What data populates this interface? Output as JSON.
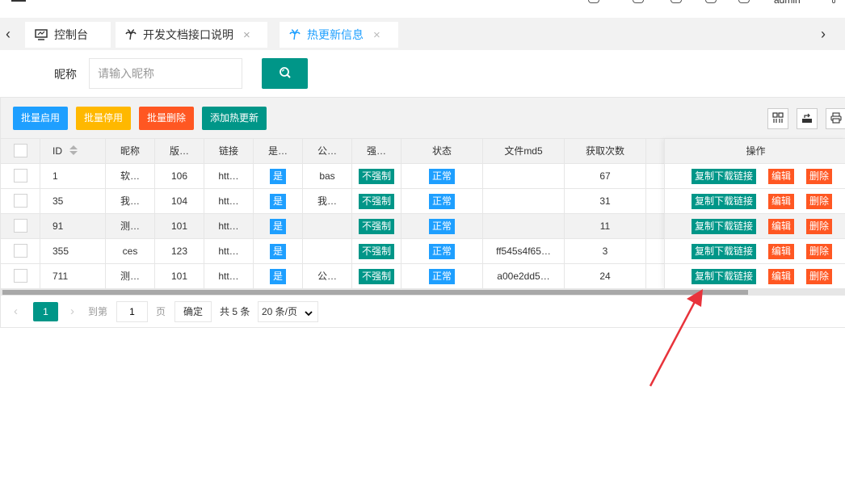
{
  "header": {
    "user_name": "admin"
  },
  "tabs": [
    {
      "label": "控制台",
      "icon": "monitor-icon",
      "closable": false,
      "active": false
    },
    {
      "label": "开发文档接口说明",
      "icon": "palm-icon",
      "closable": true,
      "active": false
    },
    {
      "label": "热更新信息",
      "icon": "palm-icon",
      "closable": true,
      "active": true
    }
  ],
  "search": {
    "label": "昵称",
    "placeholder": "请输入昵称",
    "button_icon": "search-icon"
  },
  "toolbar": {
    "batch_enable": "批量启用",
    "batch_disable": "批量停用",
    "batch_delete": "批量删除",
    "add_hot_update": "添加热更新",
    "colors": {
      "blue": "#1e9fff",
      "yellow": "#ffb800",
      "orange": "#ff5722",
      "green": "#009688"
    },
    "icons": [
      "columns-icon",
      "export-icon",
      "print-icon"
    ]
  },
  "table": {
    "headers": {
      "id": "ID",
      "nickname": "昵称",
      "version": "版…",
      "link": "链接",
      "is": "是…",
      "public": "公…",
      "force": "强…",
      "status": "状态",
      "md5": "文件md5",
      "fetch_count": "获取次数",
      "actions": "操作"
    },
    "rows": [
      {
        "id": "1",
        "nickname": "软…",
        "version": "106",
        "link": "htt…",
        "is": "是",
        "public": "bas",
        "force": "不强制",
        "status": "正常",
        "md5": "",
        "fetch_count": "67"
      },
      {
        "id": "35",
        "nickname": "我…",
        "version": "104",
        "link": "htt…",
        "is": "是",
        "public": "我…",
        "force": "不强制",
        "status": "正常",
        "md5": "",
        "fetch_count": "31"
      },
      {
        "id": "91",
        "nickname": "测…",
        "version": "101",
        "link": "htt…",
        "is": "是",
        "public": "",
        "force": "不强制",
        "status": "正常",
        "md5": "",
        "fetch_count": "11"
      },
      {
        "id": "355",
        "nickname": "ces",
        "version": "123",
        "link": "htt…",
        "is": "是",
        "public": "",
        "force": "不强制",
        "status": "正常",
        "md5": "ff545s4f65…",
        "fetch_count": "3"
      },
      {
        "id": "711",
        "nickname": "测…",
        "version": "101",
        "link": "htt…",
        "is": "是",
        "public": "公…",
        "force": "不强制",
        "status": "正常",
        "md5": "a00e2dd5…",
        "fetch_count": "24"
      }
    ],
    "row_actions": {
      "copy_link": "复制下载链接",
      "edit": "编辑",
      "delete": "删除"
    }
  },
  "pagination": {
    "current_page": "1",
    "goto_label": "到第",
    "goto_value": "1",
    "page_unit": "页",
    "confirm": "确定",
    "total": "共 5 条",
    "page_size": "20 条/页"
  }
}
